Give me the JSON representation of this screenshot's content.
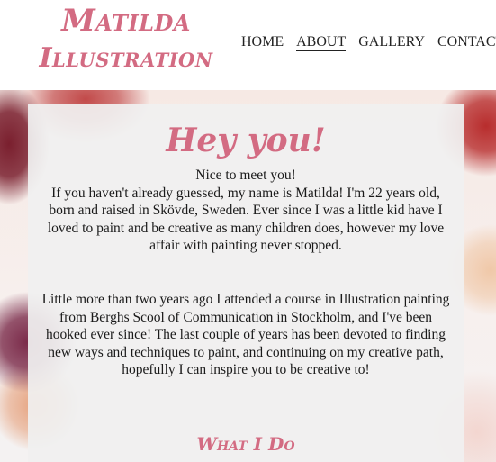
{
  "header": {
    "logo_line1": "Matilda",
    "logo_line2": "Illustration",
    "nav": [
      {
        "label": "HOME"
      },
      {
        "label": "ABOUT"
      },
      {
        "label": "GALLERY"
      },
      {
        "label": "CONTACT"
      }
    ],
    "active_nav": "ABOUT"
  },
  "about": {
    "heading": "Hey you!",
    "greeting": "Nice to meet you!",
    "paragraph1": "If you haven't already guessed, my name is Matilda! I'm 22 years old, born and raised in Skövde, Sweden. Ever since I was a little kid have I loved to paint and be creative as many children does, however my love affair with painting never stopped.",
    "paragraph2": "Little more than two years ago I attended a course in Illustration painting from Berghs Scool of Communication in Stockholm, and I've been hooked ever since! The last couple of years has been devoted to finding new ways and techniques to paint, and continuing on my creative path, hopefully I can inspire you to be creative to!",
    "subheading": "What I Do"
  },
  "colors": {
    "brand_pink": "#d36b82",
    "text": "#1a1a1a",
    "card_bg": "#f0f0f0"
  }
}
